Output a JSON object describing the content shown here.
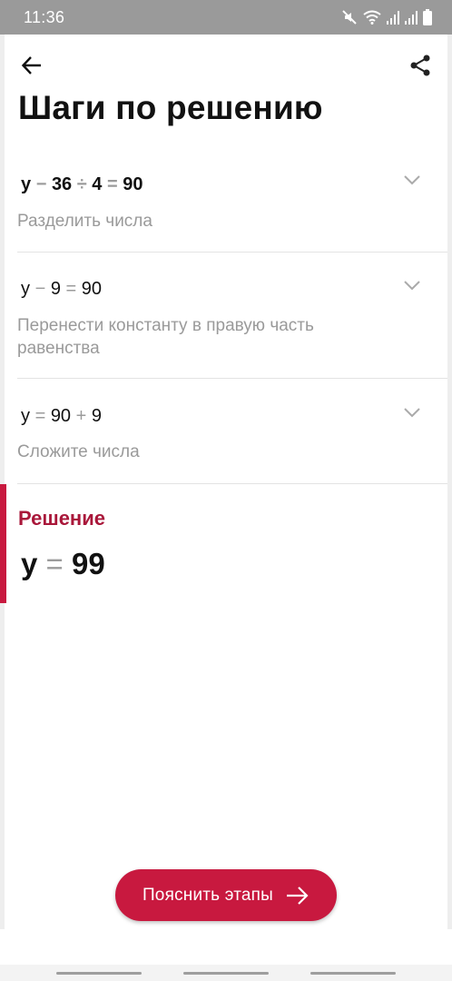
{
  "status_bar": {
    "time": "11:36",
    "icons": [
      "mute-icon",
      "wifi-icon",
      "signal-icon",
      "signal-icon",
      "battery-icon"
    ]
  },
  "header": {
    "back_icon": "arrow-left-icon",
    "share_icon": "share-icon",
    "title": "Шаги по решению"
  },
  "steps": [
    {
      "equation": {
        "a": "y",
        "op1": "−",
        "b": "36",
        "op2": "÷",
        "c": "4",
        "op3": "=",
        "d": "90"
      },
      "description": "Разделить числа"
    },
    {
      "equation": {
        "a": "y",
        "op1": "−",
        "b": "9",
        "op2": "=",
        "c": "90"
      },
      "description": "Перенести константу в правую часть равенства"
    },
    {
      "equation": {
        "a": "y",
        "op1": "=",
        "b": "90",
        "op2": "+",
        "c": "9"
      },
      "description": "Сложите числа"
    }
  ],
  "solution": {
    "label": "Решение",
    "equation": {
      "a": "y",
      "op": "=",
      "b": "99"
    }
  },
  "explain_button": {
    "label": "Пояснить этапы",
    "icon": "arrow-right-icon"
  },
  "colors": {
    "accent": "#c8193f",
    "solution_label": "#a9173a",
    "muted_text": "#9a9a9a"
  }
}
